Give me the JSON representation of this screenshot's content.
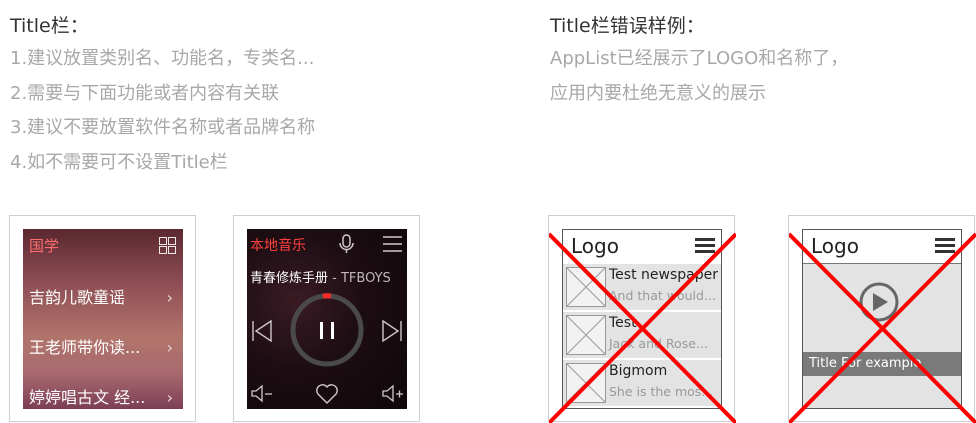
{
  "left": {
    "heading": "Title栏：",
    "lines": [
      "1.建议放置类别名、功能名，专类名...",
      "2.需要与下面功能或者内容有关联",
      "3.建议不要放置软件名称或者品牌名称",
      "4.如不需要可不设置Title栏"
    ]
  },
  "right": {
    "heading": "Title栏错误样例：",
    "lines": [
      "AppList已经展示了LOGO和名称了，",
      "应用内要杜绝无意义的展示"
    ]
  },
  "app1": {
    "title": "国学",
    "rows": [
      "吉韵儿歌童谣",
      "王老师带你读...",
      "婷婷唱古文 经..."
    ],
    "icons": [
      "grid-icon",
      "chevron-right-icon"
    ]
  },
  "app2": {
    "title": "本地音乐",
    "song": "青春修炼手册",
    "artist": " - TFBOYS",
    "icons": [
      "microphone-icon",
      "menu-icon",
      "previous-icon",
      "pause-icon",
      "next-icon",
      "volume-down-icon",
      "heart-icon",
      "volume-up-icon"
    ]
  },
  "wire1": {
    "logo": "Logo",
    "items": [
      {
        "title": "Test newspaper",
        "sub": "And that would..."
      },
      {
        "title": "Test",
        "sub": "Jack and Rose..."
      },
      {
        "title": "Bigmom",
        "sub": "She is the mos..."
      }
    ]
  },
  "wire2": {
    "logo": "Logo",
    "caption": "Title For example"
  },
  "colors": {
    "cross": "#ff0000",
    "heading": "#333333",
    "muted": "#a8a8a8",
    "app2_accent": "#ff4040"
  }
}
